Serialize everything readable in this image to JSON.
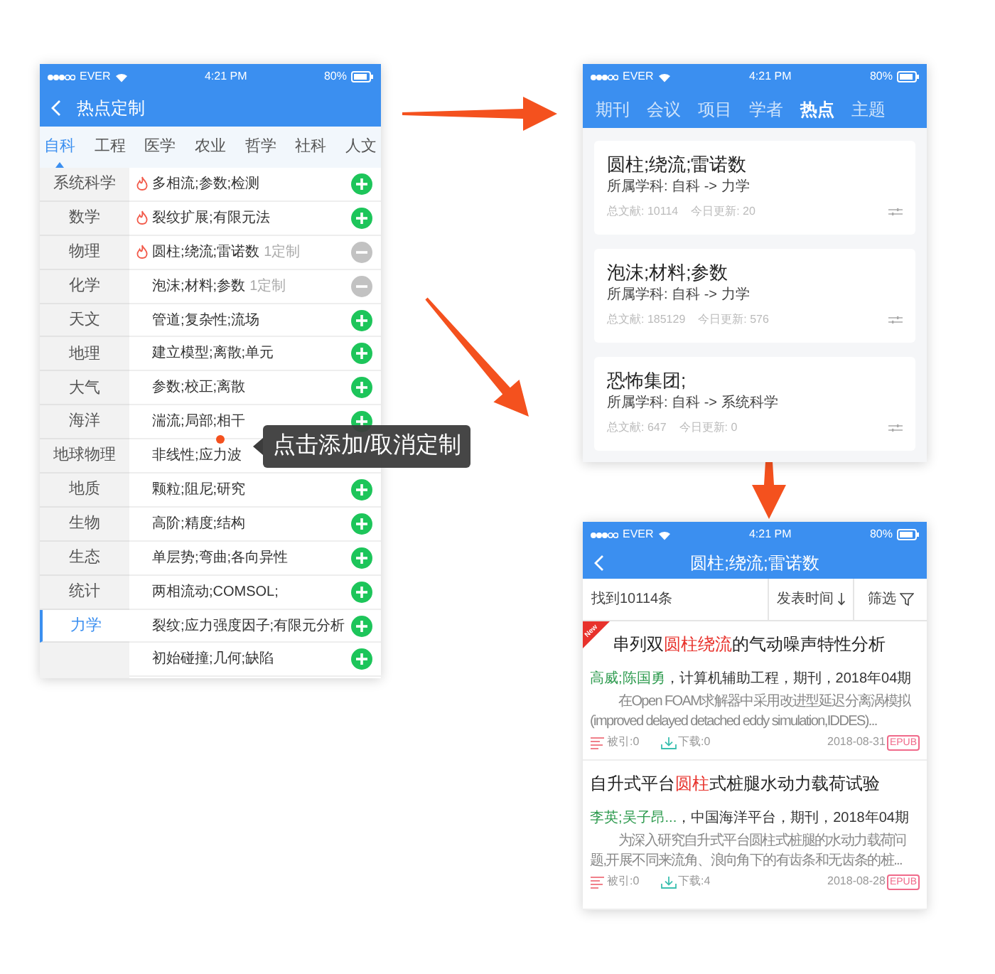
{
  "phone_left": {
    "status_bar": {
      "carrier": "EVER",
      "time": "4:21 PM",
      "battery": "80%"
    },
    "title": "热点定制",
    "tabs": [
      {
        "label": "自科",
        "selected": true
      },
      {
        "label": "工程",
        "selected": false
      },
      {
        "label": "医学",
        "selected": false
      },
      {
        "label": "农业",
        "selected": false
      },
      {
        "label": "哲学",
        "selected": false
      },
      {
        "label": "社科",
        "selected": false
      },
      {
        "label": "人文",
        "selected": false
      }
    ],
    "categories": [
      {
        "label": "系统科学",
        "selected": false
      },
      {
        "label": "数学",
        "selected": false
      },
      {
        "label": "物理",
        "selected": false
      },
      {
        "label": "化学",
        "selected": false
      },
      {
        "label": "天文",
        "selected": false
      },
      {
        "label": "地理",
        "selected": false
      },
      {
        "label": "大气",
        "selected": false
      },
      {
        "label": "海洋",
        "selected": false
      },
      {
        "label": "地球物理",
        "selected": false
      },
      {
        "label": "地质",
        "selected": false
      },
      {
        "label": "生物",
        "selected": false
      },
      {
        "label": "生态",
        "selected": false
      },
      {
        "label": "统计",
        "selected": false
      },
      {
        "label": "力学",
        "selected": true
      }
    ],
    "topics": [
      {
        "text": "多相流;参数;检测",
        "hot": true,
        "customized": false
      },
      {
        "text": "裂纹扩展;有限元法",
        "hot": true,
        "customized": false
      },
      {
        "text": "圆柱;绕流;雷诺数",
        "hot": true,
        "customized": true,
        "tag": "1定制"
      },
      {
        "text": "泡沫;材料;参数",
        "hot": false,
        "customized": true,
        "tag": "1定制"
      },
      {
        "text": "管道;复杂性;流场",
        "hot": false,
        "customized": false
      },
      {
        "text": "建立模型;离散;单元",
        "hot": false,
        "customized": false
      },
      {
        "text": "参数;校正;离散",
        "hot": false,
        "customized": false
      },
      {
        "text": "湍流;局部;相干",
        "hot": false,
        "customized": false
      },
      {
        "text": "非线性;应力波",
        "hot": false
      },
      {
        "text": "颗粒;阻尼;研究",
        "hot": false,
        "customized": false
      },
      {
        "text": "高阶;精度;结构",
        "hot": false,
        "customized": false
      },
      {
        "text": "单层势;弯曲;各向异性",
        "hot": false,
        "customized": false
      },
      {
        "text": "两相流动;COMSOL;",
        "hot": false,
        "customized": false
      },
      {
        "text": "裂纹;应力强度因子;有限元分析",
        "hot": false,
        "customized": false
      },
      {
        "text": "初始碰撞;几何;缺陷",
        "hot": false,
        "customized": false
      }
    ],
    "tooltip": "点击添加/取消定制"
  },
  "phone_top_right": {
    "status_bar": {
      "carrier": "EVER",
      "time": "4:21 PM",
      "battery": "80%"
    },
    "tabs": [
      {
        "label": "期刊",
        "selected": false
      },
      {
        "label": "会议",
        "selected": false
      },
      {
        "label": "项目",
        "selected": false
      },
      {
        "label": "学者",
        "selected": false
      },
      {
        "label": "热点",
        "selected": true
      },
      {
        "label": "主题",
        "selected": false
      }
    ],
    "cards": [
      {
        "title": "圆柱;绕流;雷诺数",
        "subject": "所属学科: 自科 -> 力学",
        "total": "总文献: 10114",
        "today": "今日更新: 20"
      },
      {
        "title": "泡沫;材料;参数",
        "subject": "所属学科: 自科 -> 力学",
        "total": "总文献: 185129",
        "today": "今日更新: 576"
      },
      {
        "title": "恐怖集团;",
        "subject": "所属学科: 自科 -> 系统科学",
        "total": "总文献: 647",
        "today": "今日更新: 0"
      }
    ]
  },
  "phone_bottom_right": {
    "status_bar": {
      "carrier": "EVER",
      "time": "4:21 PM",
      "battery": "80%"
    },
    "title": "圆柱;绕流;雷诺数",
    "result_count": "找到10114条",
    "sort": "发表时间",
    "filter": "筛选",
    "articles": [
      {
        "is_new": true,
        "ribbon": "New",
        "title_parts": [
          {
            "text": "串列双",
            "highlight": false
          },
          {
            "text": "圆柱绕流",
            "highlight": true
          },
          {
            "text": "的气动噪声特性分析",
            "highlight": false
          }
        ],
        "authors": "高威;陈国勇",
        "source": "，计算机辅助工程，期刊，2018年04期",
        "abstract": [
          "在Open FOAM求解器中采用改进型延迟分离涡模拟",
          "(improved delayed detached eddy simulation,IDDES)..."
        ],
        "cited": "被引:0",
        "downloads": "下载:0",
        "date": "2018-08-31",
        "format": "EPUB"
      },
      {
        "is_new": false,
        "title_parts": [
          {
            "text": "自升式平台",
            "highlight": false
          },
          {
            "text": "圆柱",
            "highlight": true
          },
          {
            "text": "式桩腿水动力载荷试验",
            "highlight": false
          }
        ],
        "authors": "李英;吴子昂...",
        "source": "，中国海洋平台，期刊，2018年04期",
        "abstract": [
          "为深入研究自升式平台圆柱式桩腿的水动力载荷问",
          "题,开展不同来流角、浪向角下的有齿条和无齿条的桩..."
        ],
        "cited": "被引:0",
        "downloads": "下载:4",
        "date": "2018-08-28",
        "format": "EPUB"
      }
    ]
  }
}
